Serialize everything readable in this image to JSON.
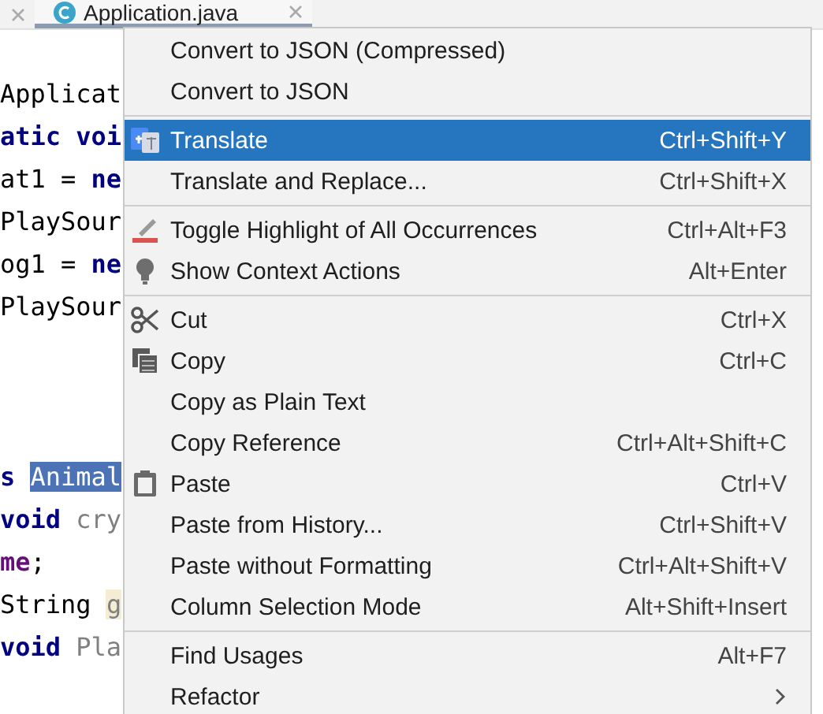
{
  "tabs": [
    {
      "label": "Application.java",
      "selected": true
    }
  ],
  "code_lines": [
    {
      "kind": "blank"
    },
    {
      "kind": "code",
      "tokens": [
        {
          "kind": "plain",
          "text": "Applicat"
        }
      ]
    },
    {
      "kind": "code",
      "tokens": [
        {
          "kind": "keyword",
          "text": "atic voi"
        }
      ]
    },
    {
      "kind": "code",
      "tokens": [
        {
          "kind": "plain",
          "text": "at1 = "
        },
        {
          "kind": "keyword",
          "text": "ne"
        }
      ]
    },
    {
      "kind": "code",
      "tokens": [
        {
          "kind": "plain",
          "text": "PlaySour"
        }
      ]
    },
    {
      "kind": "code",
      "tokens": [
        {
          "kind": "plain",
          "text": "og1 = "
        },
        {
          "kind": "keyword",
          "text": "ne"
        }
      ]
    },
    {
      "kind": "code",
      "tokens": [
        {
          "kind": "plain",
          "text": "PlaySour"
        }
      ]
    },
    {
      "kind": "blank"
    },
    {
      "kind": "blank"
    },
    {
      "kind": "blank"
    },
    {
      "kind": "code",
      "tokens": [
        {
          "kind": "keyword",
          "text": "s "
        },
        {
          "kind": "selection",
          "text": "Animal"
        }
      ]
    },
    {
      "kind": "code",
      "tokens": [
        {
          "kind": "keyword",
          "text": "void"
        },
        {
          "kind": "unused",
          "text": " cry"
        }
      ]
    },
    {
      "kind": "code",
      "tokens": [
        {
          "kind": "field",
          "text": "me"
        },
        {
          "kind": "plain",
          "text": ";"
        }
      ]
    },
    {
      "kind": "code",
      "tokens": [
        {
          "kind": "plain",
          "text": "String "
        },
        {
          "kind": "match",
          "text": "g"
        }
      ]
    },
    {
      "kind": "code",
      "tokens": [
        {
          "kind": "keyword",
          "text": "void"
        },
        {
          "kind": "unused",
          "text": " Pla"
        }
      ]
    }
  ],
  "context_menu": [
    {
      "kind": "item",
      "label": "Convert to JSON (Compressed)",
      "selected": false
    },
    {
      "kind": "item",
      "label": "Convert to JSON",
      "selected": false
    },
    {
      "kind": "separator"
    },
    {
      "kind": "item",
      "label": "Translate",
      "shortcut": "Ctrl+Shift+Y",
      "selected": true
    },
    {
      "kind": "item",
      "label": "Translate and Replace...",
      "shortcut": "Ctrl+Shift+X",
      "selected": false
    },
    {
      "kind": "separator"
    },
    {
      "kind": "item",
      "label": "Toggle Highlight of All Occurrences",
      "shortcut": "Ctrl+Alt+F3",
      "selected": false
    },
    {
      "kind": "item",
      "label": "Show Context Actions",
      "shortcut": "Alt+Enter",
      "selected": false
    },
    {
      "kind": "separator"
    },
    {
      "kind": "item",
      "label": "Cut",
      "shortcut": "Ctrl+X",
      "selected": false
    },
    {
      "kind": "item",
      "label": "Copy",
      "shortcut": "Ctrl+C",
      "selected": false
    },
    {
      "kind": "item",
      "label": "Copy as Plain Text",
      "selected": false
    },
    {
      "kind": "item",
      "label": "Copy Reference",
      "shortcut": "Ctrl+Alt+Shift+C",
      "selected": false
    },
    {
      "kind": "item",
      "label": "Paste",
      "shortcut": "Ctrl+V",
      "selected": false
    },
    {
      "kind": "item",
      "label": "Paste from History...",
      "shortcut": "Ctrl+Shift+V",
      "selected": false
    },
    {
      "kind": "item",
      "label": "Paste without Formatting",
      "shortcut": "Ctrl+Alt+Shift+V",
      "selected": false
    },
    {
      "kind": "item",
      "label": "Column Selection Mode",
      "shortcut": "Alt+Shift+Insert",
      "selected": false
    },
    {
      "kind": "separator"
    },
    {
      "kind": "item",
      "label": "Find Usages",
      "shortcut": "Alt+F7",
      "selected": false
    },
    {
      "kind": "item",
      "label": "Refactor",
      "submenu": true,
      "selected": false
    }
  ]
}
